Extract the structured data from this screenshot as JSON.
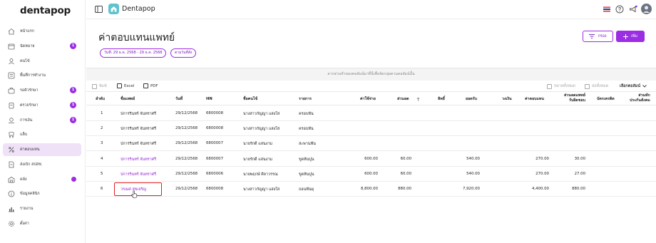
{
  "app": {
    "logo": "dentapop",
    "name": "Dentapop"
  },
  "sidebar": {
    "items": [
      {
        "label": "หน้าแรก",
        "icon": "home-icon"
      },
      {
        "label": "นัดหมาย",
        "icon": "calendar-icon",
        "badge": "1"
      },
      {
        "label": "คนไข้",
        "icon": "user-icon"
      },
      {
        "label": "พื้นที่การทำงาน",
        "icon": "workspace-icon"
      },
      {
        "label": "รอคิวรักษา",
        "icon": "queue-icon",
        "badge": "1"
      },
      {
        "label": "ตรวจรักษา",
        "icon": "clipboard-icon",
        "badge": "1"
      },
      {
        "label": "การเงิน",
        "icon": "money-icon",
        "badge": "1"
      },
      {
        "label": "แล็บ",
        "icon": "tooth-icon"
      },
      {
        "label": "ค่าตอบแทน",
        "icon": "percent-icon",
        "active": true
      },
      {
        "label": "ส่งเบิก สปสช.",
        "icon": "document-icon"
      },
      {
        "label": "คลัง",
        "icon": "warehouse-icon",
        "dot": true
      },
      {
        "label": "ข้อมูลคลินิก",
        "icon": "info-icon"
      },
      {
        "label": "รายงาน",
        "icon": "chart-icon"
      },
      {
        "label": "ตั้งค่า",
        "icon": "settings-icon"
      }
    ]
  },
  "topbar": {
    "icons": [
      "flag-icon",
      "help-icon",
      "announcement-icon",
      "avatar-icon"
    ]
  },
  "page": {
    "title": "ค่าตอบแทนแพทย์",
    "chips": [
      "วันที่: 29 ธ.ค. 2568 - 29 ธ.ค. 2568",
      "ตามวันที่สั่ง"
    ],
    "filter_label": "กรอง",
    "add_label": "เพิ่ม"
  },
  "table": {
    "drag_hint": "ลากส่วนหัวของคอลัมน์มาที่นี่เพื่อจัดกลุ่มตามคอลัมน์นั้น",
    "toolbar": {
      "print": "พิมพ์",
      "excel": "Excel",
      "pdf": "PDF",
      "expand": "ขยายทั้งหมด",
      "collapse": "ย่อทั้งหมด",
      "choose_columns": "เลือกคอลัมน์"
    },
    "headers": {
      "no": "ลำดับ",
      "doctor": "ชื่อแพทย์",
      "date": "วันที่",
      "hn": "HN",
      "patient": "ชื่อคนไข้",
      "item": "รายการ",
      "cost": "ค่าใช้จ่าย",
      "discount": "ส่วนลด",
      "rights": "สิทธิ์",
      "net": "ยอดรับ",
      "credit": "วงเงิน",
      "fee": "ค่าตอบแทน",
      "doctor_share_1": "ส่วนลดแพทย์",
      "doctor_share_2": "รับผิดชอบ",
      "card_fee": "บัตรเครดิต",
      "social_1": "ส่วนหัก",
      "social_2": "ประกันสังคม"
    },
    "rows": [
      {
        "no": "1",
        "doctor": "ปการรินทร์ จันทราศรี",
        "date": "29/12/2568",
        "hn": "6800008",
        "patient": "นางสาวกัญญา แสงใส",
        "item": "ครอบฟัน",
        "cost": "",
        "discount": "",
        "net": "",
        "fee": "",
        "share": "",
        "style": "dark"
      },
      {
        "no": "2",
        "doctor": "ปการรินทร์ จันทราศรี",
        "date": "29/12/2568",
        "hn": "6800008",
        "patient": "นางสาวกัญญา แสงใส",
        "item": "ครอบฟัน",
        "cost": "",
        "discount": "",
        "net": "",
        "fee": "",
        "share": "",
        "style": "dark"
      },
      {
        "no": "3",
        "doctor": "ปการรินทร์ จันทราศรี",
        "date": "29/12/2568",
        "hn": "6800007",
        "patient": "นายรักดี แสนงาม",
        "item": "สะพานฟัน",
        "cost": "",
        "discount": "",
        "net": "",
        "fee": "",
        "share": "",
        "style": "dark"
      },
      {
        "no": "4",
        "doctor": "ปการรินทร์ จันทราศรี",
        "date": "29/12/2568",
        "hn": "6800007",
        "patient": "นายรักดี แสนงาม",
        "item": "ขูดหินปูน",
        "cost": "600.00",
        "discount": "60.00",
        "net": "540.00",
        "fee": "270.00",
        "share": "30.00",
        "style": "purple"
      },
      {
        "no": "5",
        "doctor": "ปการรินทร์ จันทราศรี",
        "date": "29/12/2568",
        "hn": "6800006",
        "patient": "นายพฤกษ์ ศิลาวรรณ",
        "item": "ขูดหินปูน",
        "cost": "600.00",
        "discount": "60.00",
        "net": "540.00",
        "fee": "270.00",
        "share": "27.00",
        "style": "purple"
      },
      {
        "no": "6",
        "doctor": "วรเมศ สุขเจริญ",
        "date": "29/12/2568",
        "hn": "6800008",
        "patient": "นางสาวกัญญา แสงใส",
        "item": "ถอนฟันผุ",
        "cost": "8,800.00",
        "discount": "880.00",
        "net": "7,920.00",
        "fee": "4,400.00",
        "share": "880.00",
        "style": "purple",
        "highlighted": true
      }
    ]
  },
  "colors": {
    "accent": "#9b2de3",
    "active_bg": "#efe1f7",
    "highlight": "#e02020"
  }
}
